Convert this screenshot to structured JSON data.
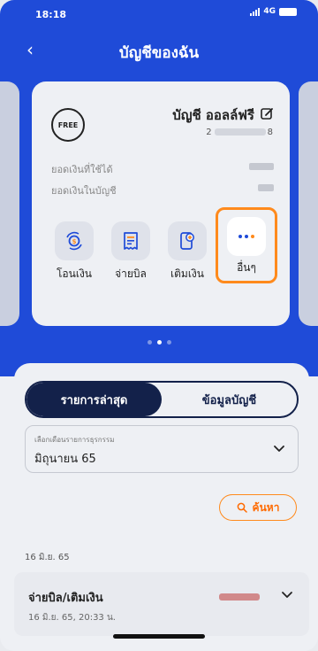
{
  "status_bar": {
    "time": "18:18",
    "network": "4G"
  },
  "header": {
    "back_glyph": "‹",
    "title": "บัญชีของฉัน"
  },
  "account_card": {
    "badge": "FREE",
    "name": "บัญชี ออลล์ฟรี",
    "number_prefix": "2",
    "number_suffix": "8",
    "available_balance_label": "ยอดเงินที่ใช้ได้",
    "account_balance_label": "ยอดเงินในบัญชี",
    "actions": [
      {
        "label": "โอนเงิน",
        "icon": "transfer-coin-icon"
      },
      {
        "label": "จ่ายบิล",
        "icon": "bill-receipt-icon"
      },
      {
        "label": "เติมเงิน",
        "icon": "mobile-topup-icon"
      },
      {
        "label": "อื่นๆ",
        "icon": "more-dots-icon"
      }
    ]
  },
  "pager": {
    "count": 3,
    "active_index": 1
  },
  "tabs": [
    {
      "label": "รายการล่าสุด",
      "active": true
    },
    {
      "label": "ข้อมูลบัญชี",
      "active": false
    }
  ],
  "month_select": {
    "caption": "เลือกเดือนรายการธุรกรรม",
    "value": "มิถุนายน 65"
  },
  "search": {
    "label": "ค้นหา"
  },
  "transactions": {
    "date_header": "16 มิ.ย. 65",
    "items": [
      {
        "title": "จ่ายบิล/เติมเงิน",
        "datetime": "16 มิ.ย. 65, 20:33 น."
      }
    ]
  },
  "colors": {
    "primary_blue": "#1f4bd8",
    "accent_orange": "#ff8a1c",
    "navy": "#13214a"
  }
}
